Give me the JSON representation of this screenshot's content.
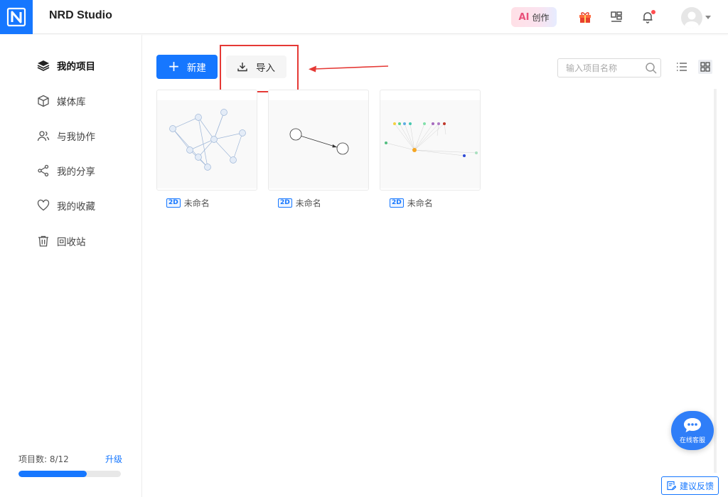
{
  "header": {
    "app_title": "NRD Studio",
    "ai_prefix": "AI",
    "ai_label": "创作",
    "icons": [
      "gift-icon",
      "layout-icon",
      "bell-icon",
      "avatar",
      "chevron-down-icon"
    ]
  },
  "sidebar": {
    "items": [
      {
        "label": "我的项目",
        "icon": "layers-icon",
        "active": true
      },
      {
        "label": "媒体库",
        "icon": "cube-icon",
        "active": false
      },
      {
        "label": "与我协作",
        "icon": "users-icon",
        "active": false
      },
      {
        "label": "我的分享",
        "icon": "share-icon",
        "active": false
      },
      {
        "label": "我的收藏",
        "icon": "heart-icon",
        "active": false
      },
      {
        "label": "回收站",
        "icon": "trash-icon",
        "active": false
      }
    ],
    "quota": {
      "label": "项目数: 8/12",
      "used": 8,
      "total": 12,
      "upgrade": "升级"
    }
  },
  "toolbar": {
    "new_label": "新建",
    "import_label": "导入",
    "search_placeholder": "输入项目名称"
  },
  "projects": [
    {
      "badge": "2D",
      "name": "未命名"
    },
    {
      "badge": "2D",
      "name": "未命名"
    },
    {
      "badge": "2D",
      "name": "未命名"
    }
  ],
  "chat": {
    "label": "在线客服"
  },
  "feedback": {
    "label": "建议反馈"
  },
  "colors": {
    "primary": "#1677ff",
    "annotation": "#e53935",
    "accent_pink": "#e8507a"
  }
}
